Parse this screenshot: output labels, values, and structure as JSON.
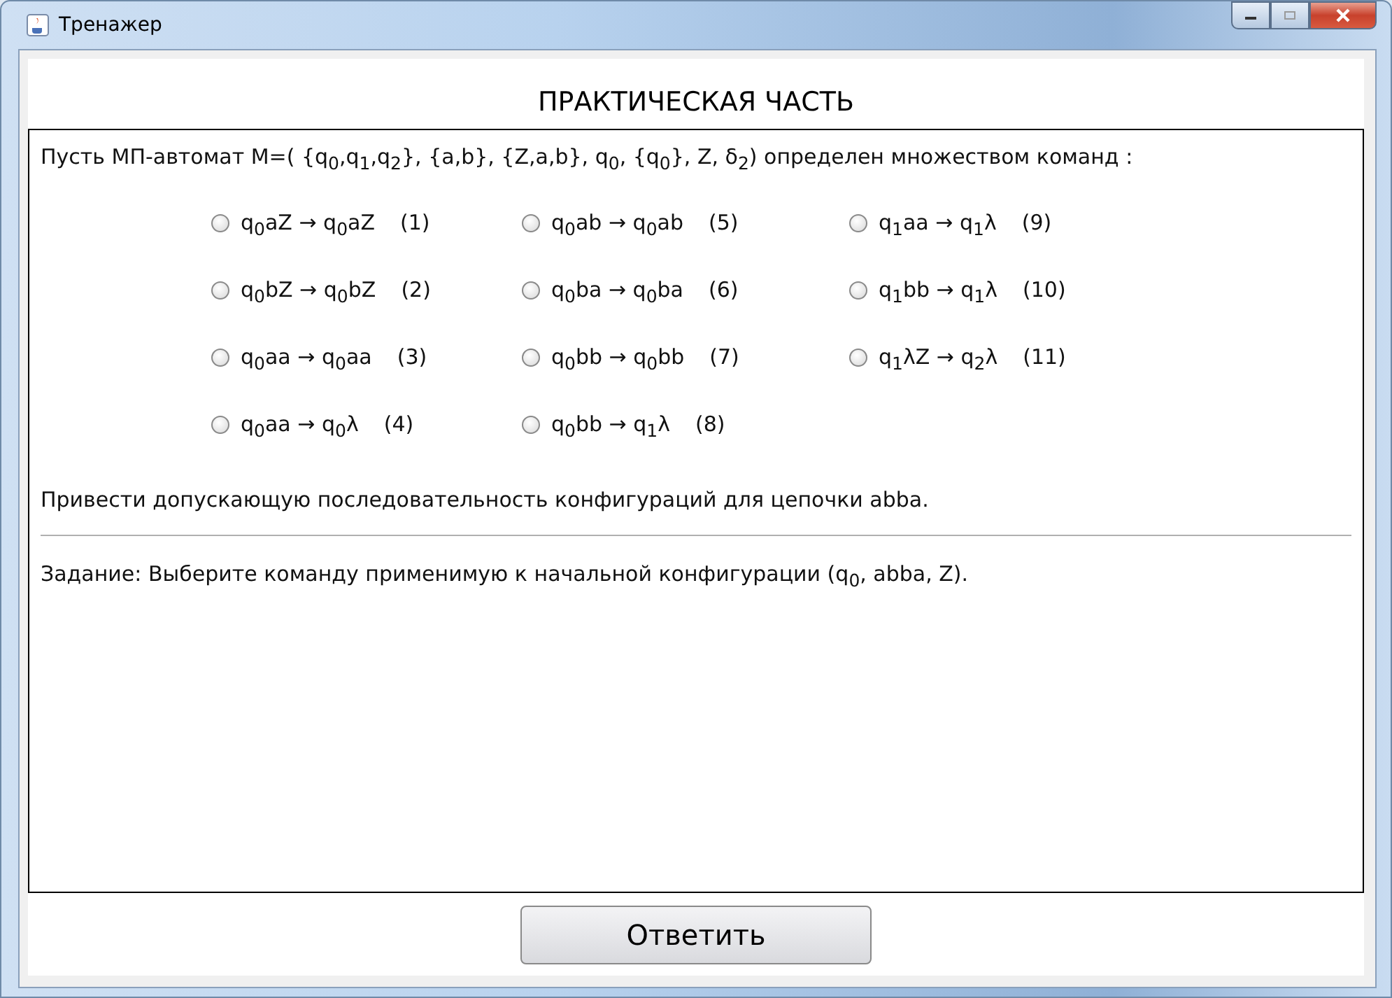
{
  "window": {
    "title": "Тренажер"
  },
  "heading": "ПРАКТИЧЕСКАЯ ЧАСТЬ",
  "intro": "Пусть МП-автомат M=( {q$_{0}$,q$_{1}$,q$_{2}$}, {a,b}, {Z,a,b}, q$_{0}$, {q$_{0}$}, Z, δ$_{2}$) определен множеством команд :",
  "commands": [
    {
      "rule": "q$_{0}$aZ → q$_{0}$aZ",
      "number": "(1)",
      "selected": false
    },
    {
      "rule": "q$_{0}$bZ → q$_{0}$bZ",
      "number": "(2)",
      "selected": false
    },
    {
      "rule": "q$_{0}$aa → q$_{0}$aa",
      "number": "(3)",
      "selected": false
    },
    {
      "rule": "q$_{0}$aa → q$_{0}$λ",
      "number": "(4)",
      "selected": false
    },
    {
      "rule": "q$_{0}$ab → q$_{0}$ab",
      "number": "(5)",
      "selected": false
    },
    {
      "rule": "q$_{0}$ba → q$_{0}$ba",
      "number": "(6)",
      "selected": false
    },
    {
      "rule": "q$_{0}$bb → q$_{0}$bb",
      "number": "(7)",
      "selected": false
    },
    {
      "rule": "q$_{0}$bb → q$_{1}$λ",
      "number": "(8)",
      "selected": false
    },
    {
      "rule": "q$_{1}$aa → q$_{1}$λ",
      "number": "(9)",
      "selected": false
    },
    {
      "rule": "q$_{1}$bb → q$_{1}$λ",
      "number": "(10)",
      "selected": false
    },
    {
      "rule": "q$_{1}$λZ → q$_{2}$λ",
      "number": "(11)",
      "selected": false
    }
  ],
  "instruction": "Привести допускающую последовательность конфигураций для цепочки abba.",
  "task": "Задание: Выберите команду применимую к начальной конфигурации (q$_{0}$, abba, Z).",
  "answer_button": "Ответить"
}
